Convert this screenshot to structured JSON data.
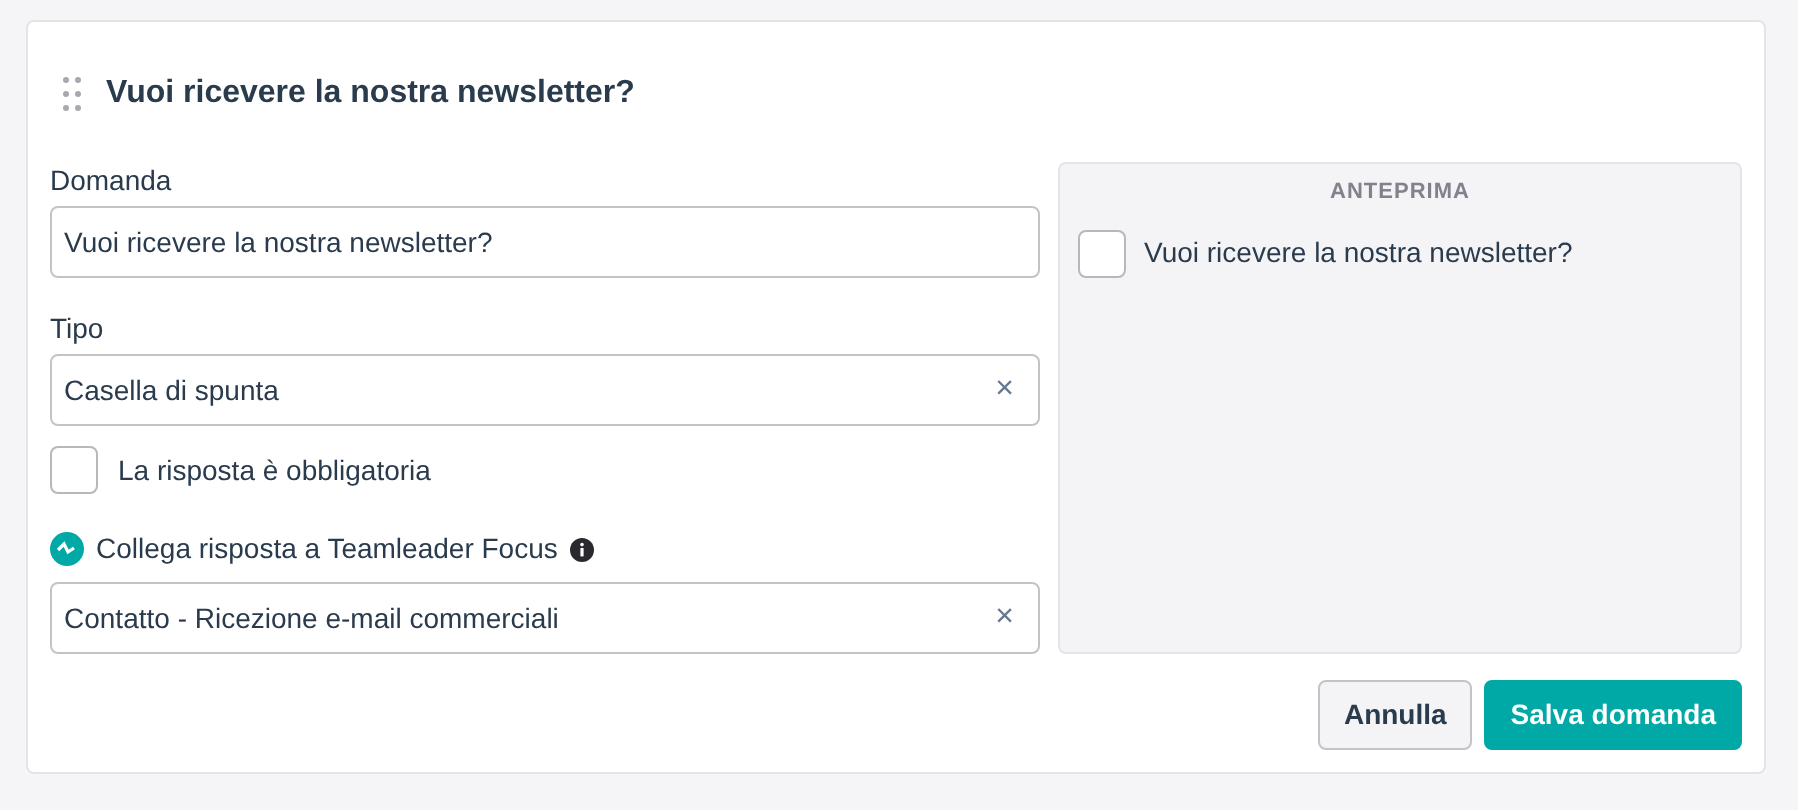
{
  "title": "Vuoi ricevere la nostra newsletter?",
  "question": {
    "label": "Domanda",
    "value": "Vuoi ricevere la nostra newsletter?"
  },
  "type": {
    "label": "Tipo",
    "value": "Casella di spunta",
    "clear": "×"
  },
  "required": {
    "label": "La risposta è obbligatoria",
    "checked": false
  },
  "link": {
    "label": "Collega risposta a Teamleader Focus",
    "value": "Contatto - Ricezione e-mail commerciali",
    "clear": "×"
  },
  "preview": {
    "title": "ANTEPRIMA",
    "label": "Vuoi ricevere la nostra newsletter?",
    "checked": false
  },
  "buttons": [
    {
      "label": "Annulla",
      "kind": "secondary"
    },
    {
      "label": "Salva domanda",
      "kind": "primary"
    }
  ]
}
